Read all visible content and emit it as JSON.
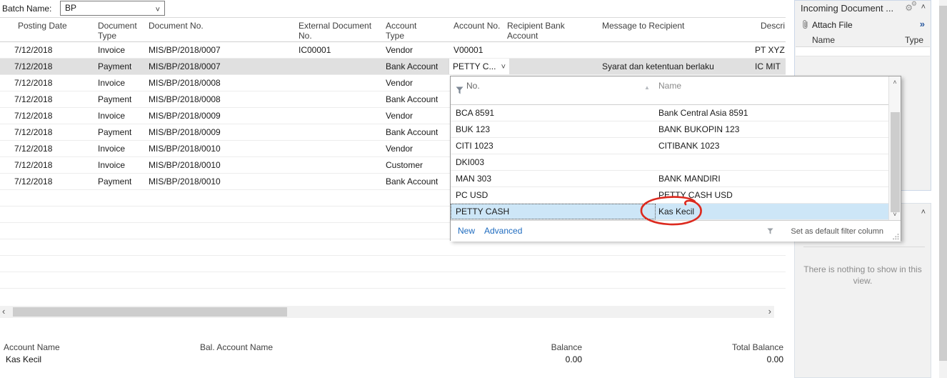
{
  "icons": {
    "chevron_down": "˅",
    "chevron_up": "˄",
    "double_chevron": "»",
    "scroll_left": "‹",
    "scroll_right": "›",
    "scroll_up": "˄",
    "scroll_down": "˅",
    "sort_asc": "▲",
    "gear": "⚙"
  },
  "colors": {
    "link_blue": "#1e6bbf",
    "selected_journal_row": "#e0e0e0",
    "dropdown_selected_row": "#cde6f7",
    "panel_background": "#f1f1f1",
    "panel_border": "#ccd8e8",
    "annotation_red": "#dc291e",
    "scrollbar_thumb": "#cdcdcd"
  },
  "batch": {
    "label": "Batch Name:",
    "value": "BP"
  },
  "journal": {
    "headers": [
      "Posting Date",
      "Document Type",
      "Document No.",
      "External Document No.",
      "Account Type",
      "Account No.",
      "Recipient Bank Account",
      "Message to Recipient",
      "Descri"
    ],
    "rows": [
      {
        "posting_date": "7/12/2018",
        "doc_type": "Invoice",
        "doc_no": "MIS/BP/2018/0007",
        "ext_doc_no": "IC00001",
        "account_type": "Vendor",
        "account_no": "V00001",
        "recipient_bank": "",
        "message": "",
        "description": "PT XYZ",
        "selected": false
      },
      {
        "posting_date": "7/12/2018",
        "doc_type": "Payment",
        "doc_no": "MIS/BP/2018/0007",
        "ext_doc_no": "",
        "account_type": "Bank Account",
        "account_no": "PETTY C...",
        "recipient_bank": "",
        "message": "Syarat dan ketentuan berlaku",
        "description": "IC MIT",
        "selected": true
      },
      {
        "posting_date": "7/12/2018",
        "doc_type": "Invoice",
        "doc_no": "MIS/BP/2018/0008",
        "ext_doc_no": "",
        "account_type": "Vendor",
        "account_no": "",
        "recipient_bank": "",
        "message": "",
        "description": "",
        "selected": false
      },
      {
        "posting_date": "7/12/2018",
        "doc_type": "Payment",
        "doc_no": "MIS/BP/2018/0008",
        "ext_doc_no": "",
        "account_type": "Bank Account",
        "account_no": "",
        "recipient_bank": "",
        "message": "",
        "description": "",
        "selected": false
      },
      {
        "posting_date": "7/12/2018",
        "doc_type": "Invoice",
        "doc_no": "MIS/BP/2018/0009",
        "ext_doc_no": "",
        "account_type": "Vendor",
        "account_no": "",
        "recipient_bank": "",
        "message": "",
        "description": "",
        "selected": false
      },
      {
        "posting_date": "7/12/2018",
        "doc_type": "Payment",
        "doc_no": "MIS/BP/2018/0009",
        "ext_doc_no": "",
        "account_type": "Bank Account",
        "account_no": "",
        "recipient_bank": "",
        "message": "",
        "description": "",
        "selected": false
      },
      {
        "posting_date": "7/12/2018",
        "doc_type": "Invoice",
        "doc_no": "MIS/BP/2018/0010",
        "ext_doc_no": "",
        "account_type": "Vendor",
        "account_no": "",
        "recipient_bank": "",
        "message": "",
        "description": "",
        "selected": false
      },
      {
        "posting_date": "7/12/2018",
        "doc_type": "Invoice",
        "doc_no": "MIS/BP/2018/0010",
        "ext_doc_no": "",
        "account_type": "Customer",
        "account_no": "",
        "recipient_bank": "",
        "message": "",
        "description": "",
        "selected": false
      },
      {
        "posting_date": "7/12/2018",
        "doc_type": "Payment",
        "doc_no": "MIS/BP/2018/0010",
        "ext_doc_no": "",
        "account_type": "Bank Account",
        "account_no": "",
        "recipient_bank": "",
        "message": "",
        "description": "",
        "selected": false
      }
    ]
  },
  "bank_dropdown": {
    "columns": {
      "no": "No.",
      "name": "Name"
    },
    "items": [
      {
        "no": "BCA 8591",
        "name": "Bank Central Asia 8591",
        "selected": false
      },
      {
        "no": "BUK 123",
        "name": "BANK BUKOPIN 123",
        "selected": false
      },
      {
        "no": "CITI 1023",
        "name": "CITIBANK 1023",
        "selected": false
      },
      {
        "no": "DKI003",
        "name": "",
        "selected": false
      },
      {
        "no": "MAN 303",
        "name": "BANK MANDIRI",
        "selected": false
      },
      {
        "no": "PC USD",
        "name": "PETTY CASH USD",
        "selected": false
      },
      {
        "no": "PETTY CASH",
        "name": "Kas Kecil",
        "selected": true
      }
    ],
    "footer": {
      "new_label": "New",
      "advanced_label": "Advanced",
      "set_default_label": "Set as default filter column"
    }
  },
  "incoming_panel": {
    "title": "Incoming Document ...",
    "attach_label": "Attach File",
    "columns": {
      "name": "Name",
      "type": "Type"
    }
  },
  "factbox": {
    "empty_line1": "There is nothing to show in this",
    "empty_line2": "view."
  },
  "totals": {
    "account_name_label": "Account Name",
    "account_name_value": "Kas Kecil",
    "bal_account_name_label": "Bal. Account Name",
    "balance_label": "Balance",
    "balance_value": "0.00",
    "total_balance_label": "Total Balance",
    "total_balance_value": "0.00"
  }
}
